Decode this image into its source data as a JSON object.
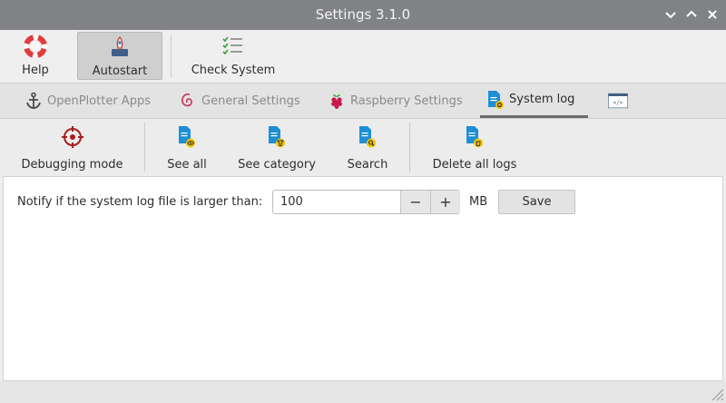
{
  "window": {
    "title": "Settings 3.1.0"
  },
  "toolbar": {
    "help_label": "Help",
    "autostart_label": "Autostart",
    "check_label": "Check System"
  },
  "tabs": [
    {
      "label": "OpenPlotter Apps",
      "icon": "anchor-icon"
    },
    {
      "label": "General Settings",
      "icon": "debian-swirl-icon"
    },
    {
      "label": "Raspberry Settings",
      "icon": "raspberry-icon"
    },
    {
      "label": "System log",
      "icon": "doc-gear-icon",
      "active": true
    },
    {
      "label": "",
      "icon": "code-window-icon"
    }
  ],
  "actions": {
    "debug_label": "Debugging mode",
    "see_all_label": "See all",
    "see_category_label": "See category",
    "search_label": "Search",
    "delete_label": "Delete all logs"
  },
  "log": {
    "notify_label": "Notify if the system log file is larger than:",
    "size_value": "100",
    "minus": "−",
    "plus": "+",
    "unit": "MB",
    "save_label": "Save"
  },
  "colors": {
    "titlebar": "#808285",
    "doc_icon": "#1e8fd6",
    "badge": "#f2c300",
    "help_red": "#e23b3b",
    "crosshair": "#a51f1f",
    "checks_green": "#3aa03a"
  }
}
